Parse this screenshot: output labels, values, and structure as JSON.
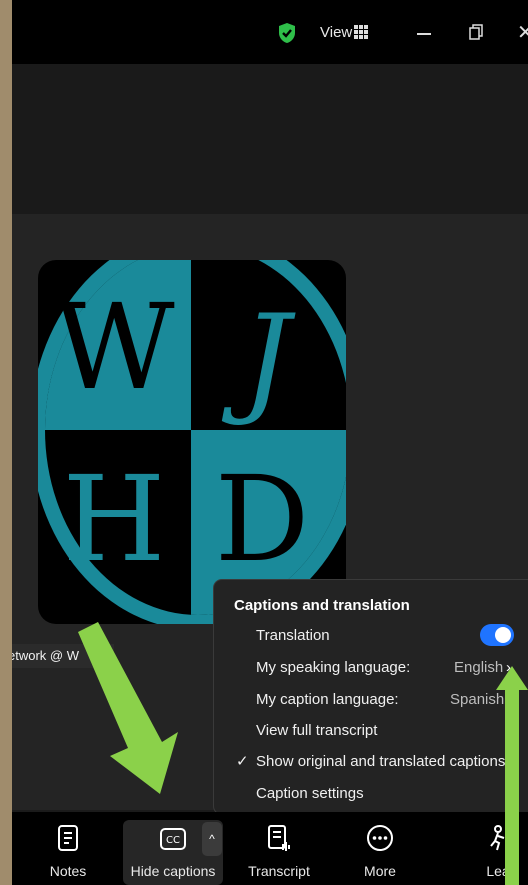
{
  "titlebar": {
    "view_label": "View",
    "icons": [
      "shield-check-icon",
      "grid-icon",
      "minimize-icon",
      "restore-icon",
      "close-icon"
    ],
    "close_glyph": "✕"
  },
  "video": {
    "participant_name": "etwork @ W"
  },
  "captions_menu": {
    "title": "Captions and translation",
    "translation_label": "Translation",
    "translation_enabled": true,
    "speaking_language_label": "My speaking language:",
    "speaking_language_value": "English",
    "chevron_glyph": "›",
    "caption_language_label": "My caption language:",
    "caption_language_value": "Spanish",
    "view_transcript_label": "View full transcript",
    "check_glyph": "✓",
    "show_original_label": "Show original and translated captions",
    "caption_settings_label": "Caption settings"
  },
  "toolbar": {
    "notes_label": "Notes",
    "hide_captions_label": "Hide captions",
    "caret_glyph": "^",
    "transcript_label": "Transcript",
    "more_label": "More",
    "leave_label": "Lea"
  },
  "colors": {
    "accent_blue": "#1f74ff",
    "arrow_green": "#8bd14a",
    "logo_teal": "#1a8a9a",
    "shield_green": "#2fbf4a"
  }
}
